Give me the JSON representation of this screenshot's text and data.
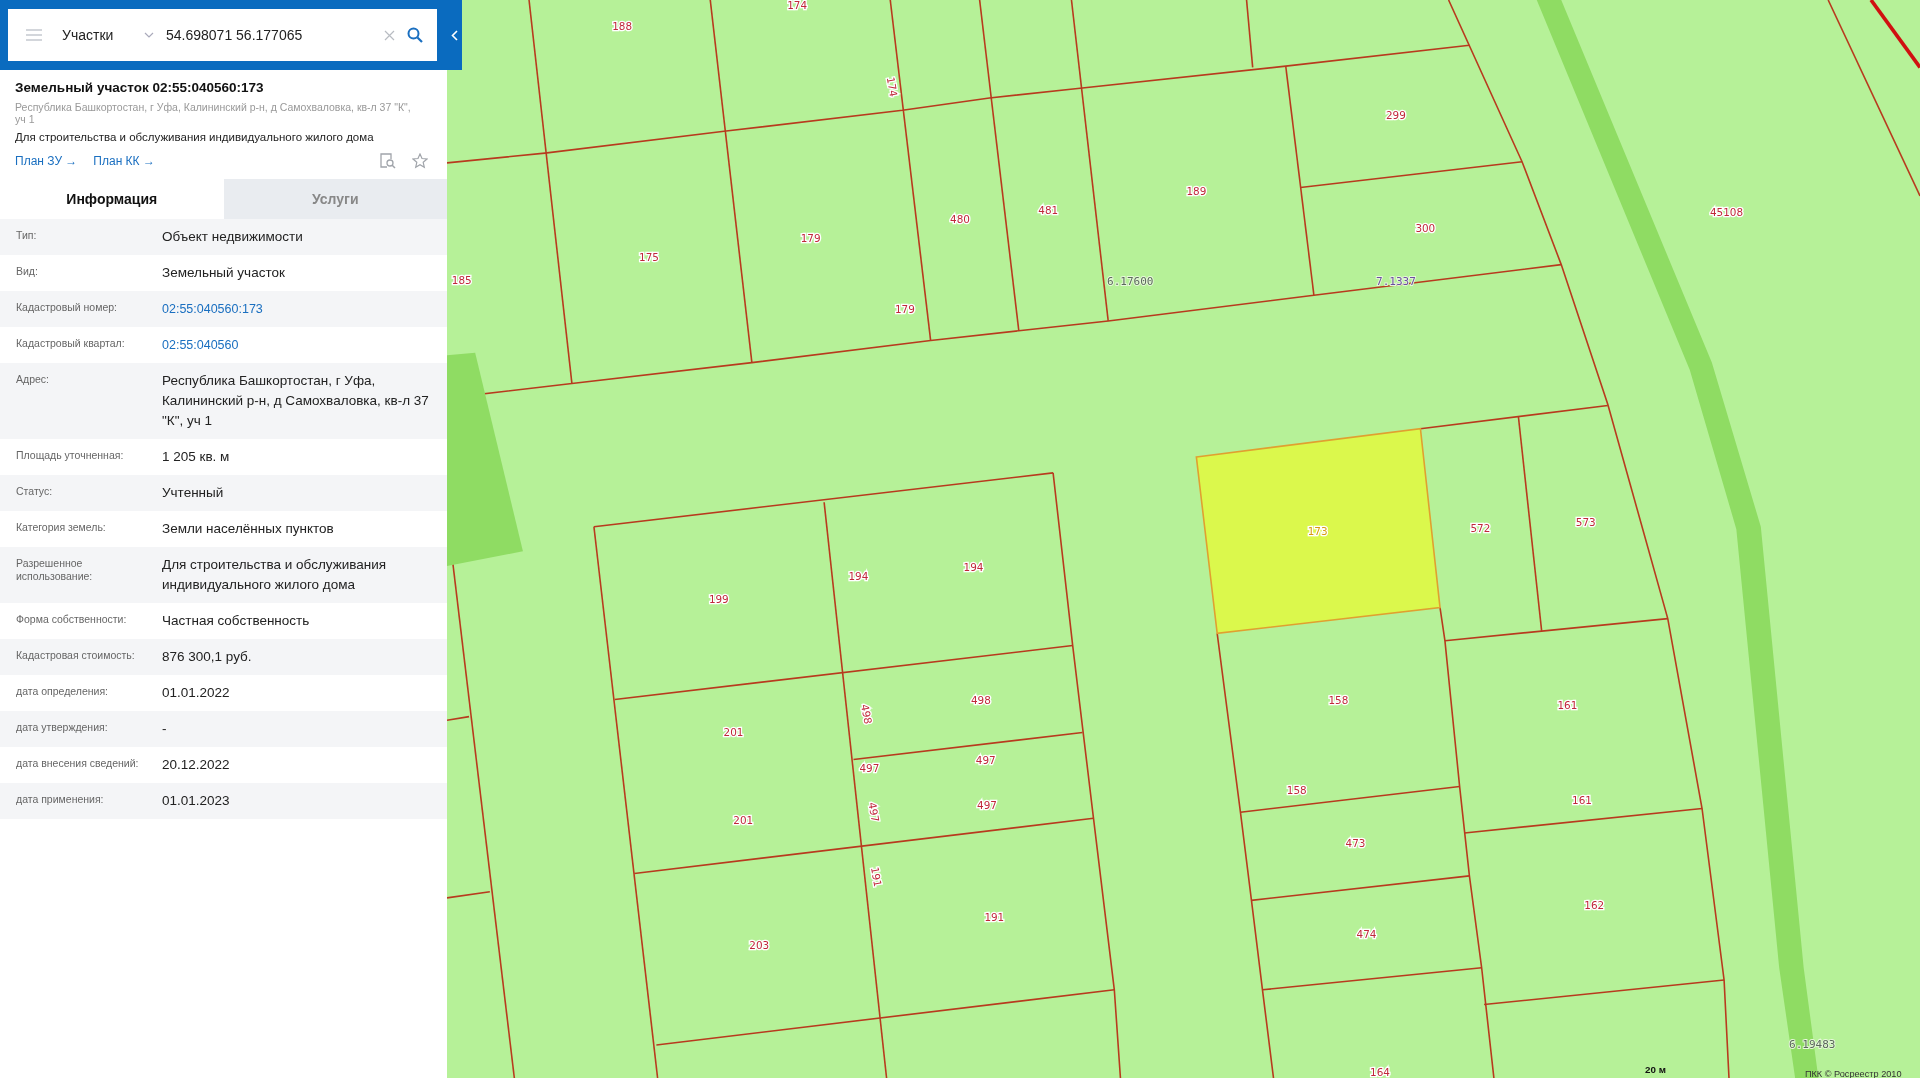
{
  "search": {
    "layer": "Участки",
    "value": "54.698071 56.177065"
  },
  "object": {
    "title": "Земельный участок 02:55:040560:173",
    "address": "Республика Башкортостан, г Уфа, Калининский р-н, д Самохваловка, кв-л 37 \"К\", уч 1",
    "purpose": "Для строительства и обслуживания индивидуального жилого дома",
    "links": [
      "План ЗУ →",
      "План КК →"
    ]
  },
  "tabs": [
    {
      "label": "Информация",
      "selected": true
    },
    {
      "label": "Услуги",
      "selected": false
    }
  ],
  "properties": [
    {
      "label": "Тип:",
      "value": "Объект недвижимости",
      "kind": "text"
    },
    {
      "label": "Вид:",
      "value": "Земельный участок",
      "kind": "text"
    },
    {
      "label": "Кадастровый номер:",
      "value": "02:55:040560:173",
      "kind": "link"
    },
    {
      "label": "Кадастровый квартал:",
      "value": "02:55:040560",
      "kind": "link"
    },
    {
      "label": "Адрес:",
      "value": "Республика Башкортостан, г Уфа, Калининский р-н, д Самохваловка, кв-л 37 \"К\", уч 1",
      "kind": "text"
    },
    {
      "label": "Площадь уточненная:",
      "value": "1 205 кв. м",
      "kind": "text"
    },
    {
      "label": "Статус:",
      "value": "Учтенный",
      "kind": "text"
    },
    {
      "label": "Категория земель:",
      "value": "Земли населённых пунктов",
      "kind": "text"
    },
    {
      "label": "Разрешенное использование:",
      "value": "Для строительства и обслуживания индивидуального жилого дома",
      "kind": "text"
    },
    {
      "label": "Форма собственности:",
      "value": "Частная собственность",
      "kind": "text"
    },
    {
      "label": "Кадастровая стоимость:",
      "value": "876 300,1 руб.",
      "kind": "text"
    },
    {
      "label": "дата определения:",
      "value": "01.01.2022",
      "kind": "text"
    },
    {
      "label": "дата утверждения:",
      "value": "-",
      "kind": "text"
    },
    {
      "label": "дата внесения сведений:",
      "value": "20.12.2022",
      "kind": "text"
    },
    {
      "label": "дата применения:",
      "value": "01.01.2023",
      "kind": "text"
    }
  ],
  "map": {
    "parcels": [
      {
        "label": "188",
        "selected": false
      },
      {
        "label": "174",
        "selected": false
      },
      {
        "label": "174",
        "selected": false
      },
      {
        "label": "185",
        "selected": false
      },
      {
        "label": "175",
        "selected": false
      },
      {
        "label": "179",
        "selected": false
      },
      {
        "label": "179",
        "selected": false
      },
      {
        "label": "480",
        "selected": false
      },
      {
        "label": "481",
        "selected": false
      },
      {
        "label": "189",
        "selected": false
      },
      {
        "label": "299",
        "selected": false
      },
      {
        "label": "300",
        "selected": false
      },
      {
        "label": "45108",
        "selected": false
      },
      {
        "label": "199",
        "selected": false
      },
      {
        "label": "194",
        "selected": false
      },
      {
        "label": "194",
        "selected": false
      },
      {
        "label": "498",
        "selected": false
      },
      {
        "label": "498",
        "selected": false
      },
      {
        "label": "201",
        "selected": false
      },
      {
        "label": "201",
        "selected": false
      },
      {
        "label": "497",
        "selected": false
      },
      {
        "label": "497",
        "selected": false
      },
      {
        "label": "497",
        "selected": false
      },
      {
        "label": "497",
        "selected": false
      },
      {
        "label": "191",
        "selected": false
      },
      {
        "label": "191",
        "selected": false
      },
      {
        "label": "203",
        "selected": false
      },
      {
        "label": "173",
        "selected": true
      },
      {
        "label": "572",
        "selected": false
      },
      {
        "label": "573",
        "selected": false
      },
      {
        "label": "158",
        "selected": false
      },
      {
        "label": "158",
        "selected": false
      },
      {
        "label": "161",
        "selected": false
      },
      {
        "label": "161",
        "selected": false
      },
      {
        "label": "473",
        "selected": false
      },
      {
        "label": "474",
        "selected": false
      },
      {
        "label": "162",
        "selected": false
      },
      {
        "label": "164",
        "selected": false
      }
    ],
    "quarter_labels": [
      "6.17600",
      "7.1337",
      "6.19483"
    ],
    "scale": "20 м",
    "attribution": "ПКК © Росреестр 2010"
  }
}
